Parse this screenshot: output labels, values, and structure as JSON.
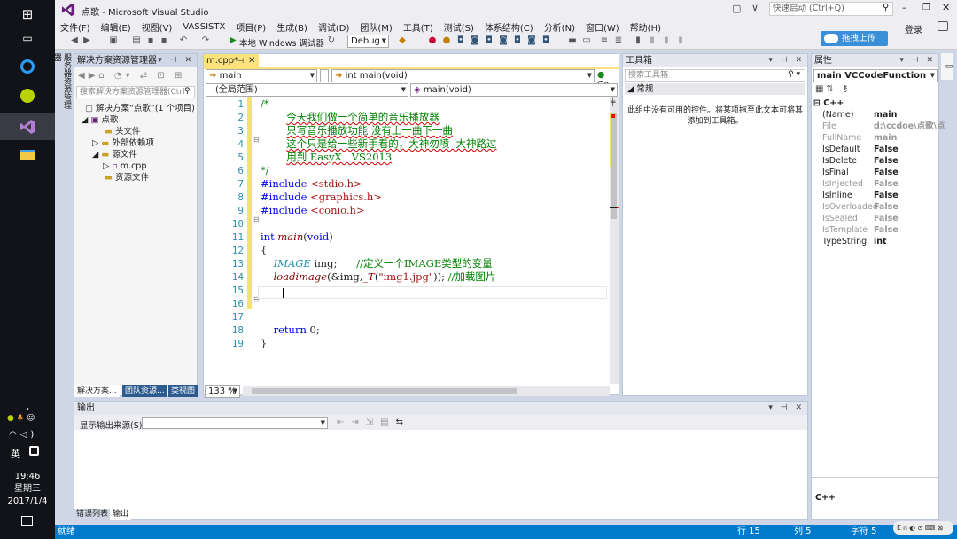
{
  "window": {
    "title": "点歌 - Microsoft Visual Studio",
    "quick_launch_placeholder": "快速启动 (Ctrl+Q)",
    "signin": "登录",
    "upload_btn": "拖拽上传"
  },
  "menu": [
    "文件(F)",
    "编辑(E)",
    "视图(V)",
    "VASSISTX",
    "项目(P)",
    "生成(B)",
    "调试(D)",
    "团队(M)",
    "工具(T)",
    "测试(S)",
    "体系结构(C)",
    "分析(N)",
    "窗口(W)",
    "帮助(H)"
  ],
  "toolbar": {
    "debugger_label": "本地 Windows 调试器",
    "config": "Debug"
  },
  "solution_explorer": {
    "title": "解决方案资源管理器",
    "vertical_tab": "服务器资源管理器",
    "search_placeholder": "搜索解决方案资源管理器(Ctrl",
    "tree": [
      "解决方案“点歌”(1 个项目)",
      "点歌",
      "头文件",
      "外部依赖项",
      "源文件",
      "m.cpp",
      "资源文件"
    ],
    "bottom_tabs": [
      "解决方案...",
      "团队资源...",
      "类视图"
    ]
  },
  "editor": {
    "tab": "m.cpp*",
    "scope_left": "main",
    "scope_mid": "int main(void)",
    "go": "Go",
    "nav_left": "(全局范围)",
    "nav_right": "main(void)",
    "zoom": "133 %",
    "lines": [
      {
        "n": "1",
        "parts": [
          {
            "t": "/*",
            "c": "cm"
          }
        ]
      },
      {
        "n": "2",
        "parts": [
          {
            "t": "        ",
            "c": ""
          },
          {
            "t": "今天我们做一个简单的音乐播放器",
            "c": "cm squig"
          }
        ]
      },
      {
        "n": "3",
        "parts": [
          {
            "t": "        ",
            "c": ""
          },
          {
            "t": "只写音乐播放功能 没有上一曲下一曲",
            "c": "cm squig"
          }
        ]
      },
      {
        "n": "4",
        "parts": [
          {
            "t": "        ",
            "c": ""
          },
          {
            "t": "这个只是给一些新手看的，大神勿喷  大神路过",
            "c": "cm squig"
          }
        ]
      },
      {
        "n": "5",
        "parts": [
          {
            "t": "        ",
            "c": ""
          },
          {
            "t": "用到 EasyX   VS2013",
            "c": "cm squig"
          }
        ]
      },
      {
        "n": "6",
        "parts": [
          {
            "t": "*/",
            "c": "cm"
          }
        ]
      },
      {
        "n": "7",
        "parts": [
          {
            "t": "#include ",
            "c": "kw"
          },
          {
            "t": "<stdio.h>",
            "c": "inc"
          }
        ]
      },
      {
        "n": "8",
        "parts": [
          {
            "t": "#include ",
            "c": "kw"
          },
          {
            "t": "<graphics.h>",
            "c": "inc"
          }
        ]
      },
      {
        "n": "9",
        "parts": [
          {
            "t": "#include ",
            "c": "kw"
          },
          {
            "t": "<conio.h>",
            "c": "inc"
          }
        ]
      },
      {
        "n": "10",
        "parts": []
      },
      {
        "n": "11",
        "parts": [
          {
            "t": "int ",
            "c": "kw"
          },
          {
            "t": "main",
            "c": "fn"
          },
          {
            "t": "(",
            "c": ""
          },
          {
            "t": "void",
            "c": "kw"
          },
          {
            "t": ")",
            "c": ""
          }
        ]
      },
      {
        "n": "12",
        "parts": [
          {
            "t": "{",
            "c": ""
          }
        ]
      },
      {
        "n": "13",
        "parts": [
          {
            "t": "    ",
            "c": ""
          },
          {
            "t": "IMAGE",
            "c": "ty"
          },
          {
            "t": " img;      ",
            "c": ""
          },
          {
            "t": "//定义一个IMAGE类型的变量",
            "c": "cm"
          }
        ]
      },
      {
        "n": "14",
        "parts": [
          {
            "t": "    ",
            "c": ""
          },
          {
            "t": "loadimage",
            "c": "fn"
          },
          {
            "t": "(&img,",
            "c": ""
          },
          {
            "t": "_T",
            "c": "fn"
          },
          {
            "t": "(",
            "c": ""
          },
          {
            "t": "\"img1.jpg\"",
            "c": "str"
          },
          {
            "t": ")); ",
            "c": ""
          },
          {
            "t": "//加载图片",
            "c": "cm"
          }
        ]
      },
      {
        "n": "15",
        "parts": [
          {
            "t": "    ",
            "c": ""
          }
        ]
      },
      {
        "n": "16",
        "parts": []
      },
      {
        "n": "17",
        "parts": []
      },
      {
        "n": "18",
        "parts": [
          {
            "t": "    ",
            "c": ""
          },
          {
            "t": "return ",
            "c": "kw"
          },
          {
            "t": "0;",
            "c": ""
          }
        ]
      },
      {
        "n": "19",
        "parts": [
          {
            "t": "}",
            "c": ""
          }
        ]
      }
    ]
  },
  "toolbox": {
    "title": "工具箱",
    "search_placeholder": "搜索工具箱",
    "section": "常规",
    "empty_msg_1": "此组中没有可用的控件。将某项拖至此文本可将其",
    "empty_msg_2": "添加到工具箱。"
  },
  "properties": {
    "title": "属性",
    "object": "main VCCodeFunction",
    "category": "C++",
    "rows": [
      {
        "k": "(Name)",
        "v": "main",
        "dim": false
      },
      {
        "k": "File",
        "v": "d:\\ccdoe\\点歌\\点",
        "dim": true
      },
      {
        "k": "FullName",
        "v": "main",
        "dim": true
      },
      {
        "k": "IsDefault",
        "v": "False",
        "dim": false
      },
      {
        "k": "IsDelete",
        "v": "False",
        "dim": false
      },
      {
        "k": "IsFinal",
        "v": "False",
        "dim": false
      },
      {
        "k": "IsInjected",
        "v": "False",
        "dim": true
      },
      {
        "k": "IsInline",
        "v": "False",
        "dim": false
      },
      {
        "k": "IsOverloaded",
        "v": "False",
        "dim": true
      },
      {
        "k": "IsSealed",
        "v": "False",
        "dim": true
      },
      {
        "k": "IsTemplate",
        "v": "False",
        "dim": true
      },
      {
        "k": "TypeString",
        "v": "int",
        "dim": false
      }
    ],
    "desc": "C++"
  },
  "output": {
    "title": "输出",
    "source_label": "显示输出来源(S):",
    "tabs": [
      "错误列表",
      "输出"
    ]
  },
  "status": {
    "ready": "就绪",
    "line": "行 15",
    "col": "列 5",
    "ch": "字符 5"
  },
  "clock": {
    "time": "19:46",
    "weekday": "星期三",
    "date": "2017/1/4",
    "ime": "英"
  },
  "colors": {
    "accent": "#007acc",
    "vs_purple": "#68217a"
  }
}
